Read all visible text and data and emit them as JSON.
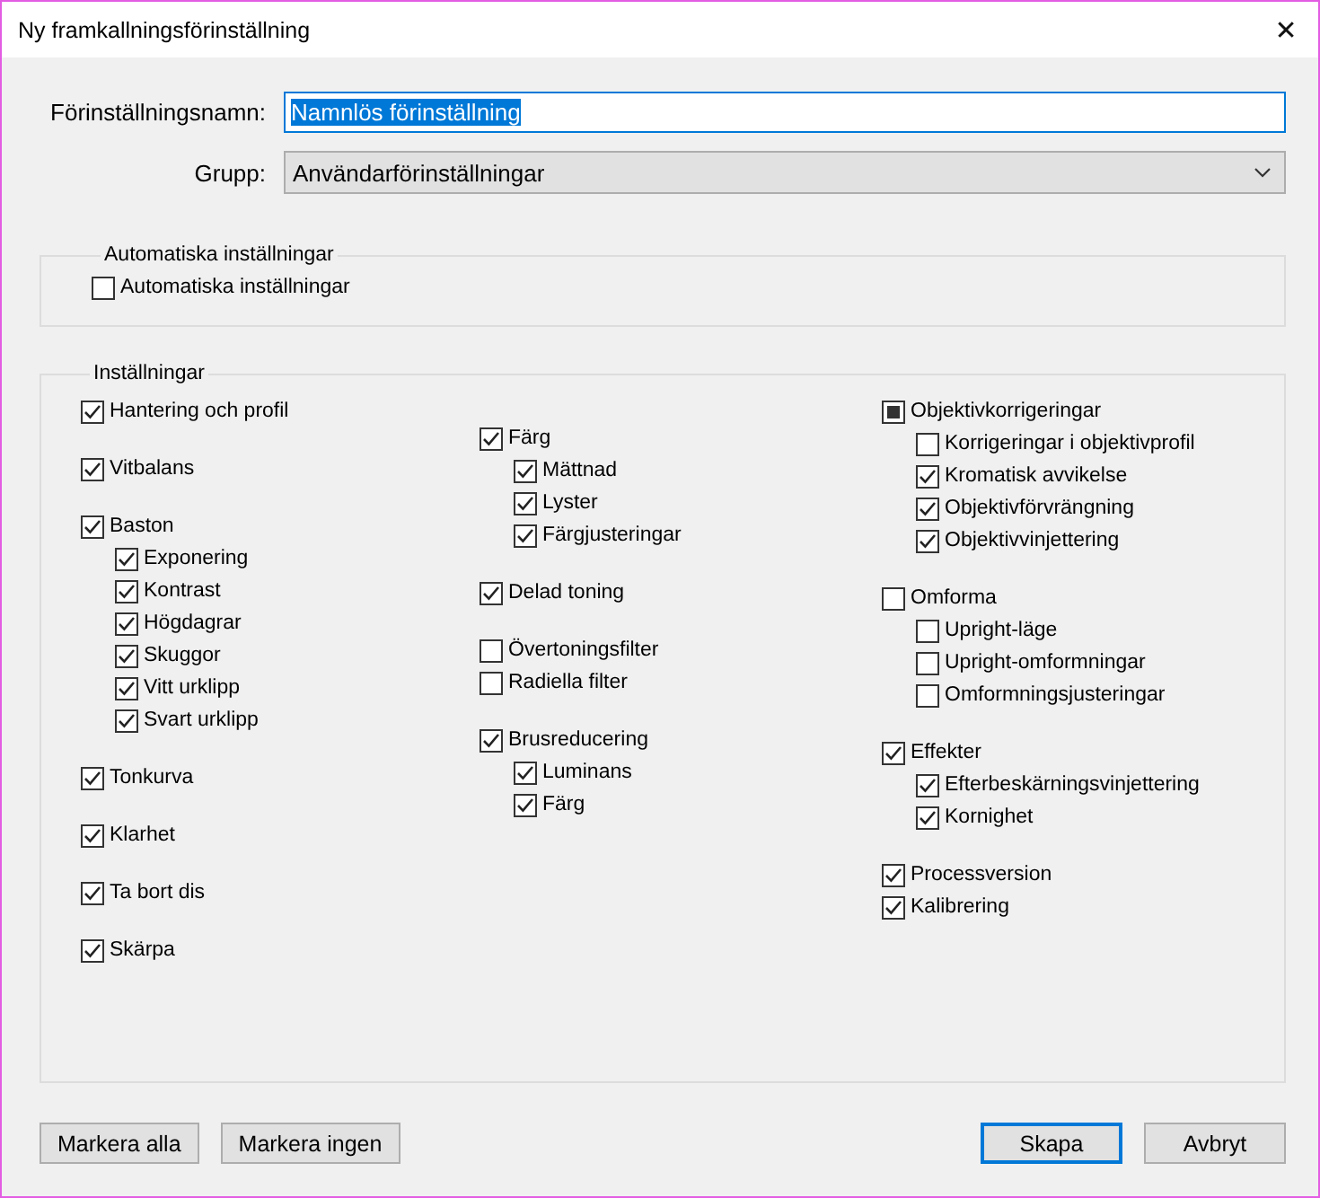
{
  "window": {
    "title": "Ny framkallningsförinställning",
    "close": "✕"
  },
  "name_field": {
    "label": "Förinställningsnamn:",
    "value": "Namnlös förinställning",
    "selected": true
  },
  "group_field": {
    "label": "Grupp:",
    "value": "Användarförinställningar"
  },
  "auto_group": {
    "title": "Automatiska inställningar",
    "items": [
      {
        "label": "Automatiska inställningar",
        "checked": false
      }
    ]
  },
  "settings": {
    "title": "Inställningar",
    "columns": [
      [
        [
          {
            "label": "Hantering och profil",
            "checked": true
          }
        ],
        [
          {
            "label": "Vitbalans",
            "checked": true
          }
        ],
        [
          {
            "label": "Baston",
            "checked": true,
            "children": [
              {
                "label": "Exponering",
                "checked": true
              },
              {
                "label": "Kontrast",
                "checked": true
              },
              {
                "label": "Högdagrar",
                "checked": true
              },
              {
                "label": "Skuggor",
                "checked": true
              },
              {
                "label": "Vitt urklipp",
                "checked": true
              },
              {
                "label": "Svart urklipp",
                "checked": true
              }
            ]
          }
        ],
        [
          {
            "label": "Tonkurva",
            "checked": true
          }
        ],
        [
          {
            "label": "Klarhet",
            "checked": true
          }
        ],
        [
          {
            "label": "Ta bort dis",
            "checked": true
          }
        ],
        [
          {
            "label": "Skärpa",
            "checked": true
          }
        ]
      ],
      [
        [
          {
            "label": "Färg",
            "checked": true,
            "children": [
              {
                "label": "Mättnad",
                "checked": true
              },
              {
                "label": "Lyster",
                "checked": true
              },
              {
                "label": "Färgjusteringar",
                "checked": true
              }
            ]
          }
        ],
        [
          {
            "label": "Delad toning",
            "checked": true
          }
        ],
        [
          {
            "label": "Övertoningsfilter",
            "checked": false
          },
          {
            "label": "Radiella filter",
            "checked": false
          }
        ],
        [
          {
            "label": "Brusreducering",
            "checked": true,
            "children": [
              {
                "label": "Luminans",
                "checked": true
              },
              {
                "label": "Färg",
                "checked": true
              }
            ]
          }
        ]
      ],
      [
        [
          {
            "label": "Objektivkorrigeringar",
            "mixed": true,
            "children": [
              {
                "label": "Korrigeringar i objektivprofil",
                "checked": false
              },
              {
                "label": "Kromatisk avvikelse",
                "checked": true
              },
              {
                "label": "Objektivförvrängning",
                "checked": true
              },
              {
                "label": "Objektivvinjettering",
                "checked": true
              }
            ]
          }
        ],
        [
          {
            "label": "Omforma",
            "checked": false,
            "children": [
              {
                "label": "Upright-läge",
                "checked": false
              },
              {
                "label": "Upright-omformningar",
                "checked": false
              },
              {
                "label": "Omformningsjusteringar",
                "checked": false
              }
            ]
          }
        ],
        [
          {
            "label": "Effekter",
            "checked": true,
            "children": [
              {
                "label": "Efterbeskärningsvinjettering",
                "checked": true
              },
              {
                "label": "Kornighet",
                "checked": true
              }
            ]
          }
        ],
        [
          {
            "label": "Processversion",
            "checked": true
          },
          {
            "label": "Kalibrering",
            "checked": true
          }
        ]
      ]
    ]
  },
  "buttons_left": [
    "Markera alla",
    "Markera ingen"
  ],
  "buttons_right": [
    {
      "label": "Skapa",
      "default": true
    },
    {
      "label": "Avbryt",
      "default": false
    }
  ]
}
